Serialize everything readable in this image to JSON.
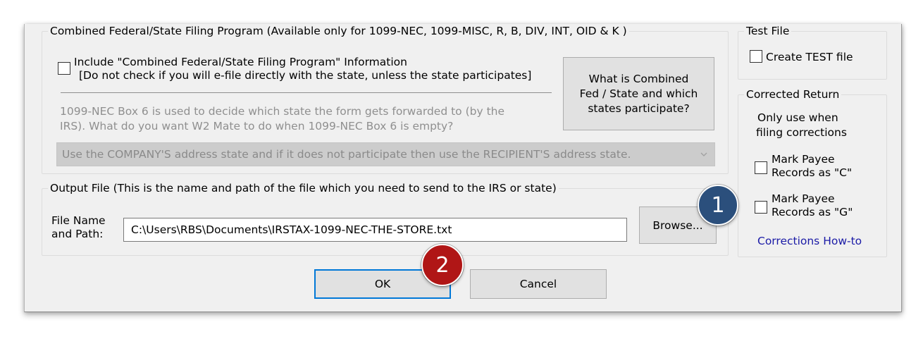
{
  "combined_group": {
    "legend": "Combined Federal/State Filing Program (Available only for 1099-NEC, 1099-MISC, R, B, DIV, INT, OID & K )",
    "include_label_line1": "Include \"Combined Federal/State Filing Program\" Information",
    "include_label_line2": "[Do not check if you will e-file directly with the state, unless the state participates]",
    "include_checked": false,
    "info_line1": "1099-NEC Box 6 is used to decide which state the form gets forwarded to (by the",
    "info_line2": "IRS). What do you want W2 Mate to do when 1099-NEC Box 6 is empty?",
    "state_select_value": "Use the COMPANY'S address state and if it does not participate then use the RECIPIENT'S address state.",
    "what_is_button": {
      "line1": "What is Combined",
      "line2": "Fed / State and which",
      "line3": "states participate?"
    }
  },
  "test_file_group": {
    "legend": "Test File",
    "create_test_label": "Create TEST file",
    "create_test_checked": false
  },
  "corrected_group": {
    "legend": "Corrected Return",
    "note_line1": "Only use when",
    "note_line2": "filing corrections",
    "mark_c_line1": "Mark Payee",
    "mark_c_line2": "Records as \"C\"",
    "mark_g_line1": "Mark Payee",
    "mark_g_line2": "Records as \"G\"",
    "mark_c_checked": false,
    "mark_g_checked": false,
    "howto_link": "Corrections How-to"
  },
  "output_group": {
    "legend": "Output File (This is the name and path of the file which you need to send to the IRS or state)",
    "file_label_line1": "File Name",
    "file_label_line2": "and Path:",
    "file_path_value": "C:\\Users\\RBS\\Documents\\IRSTAX-1099-NEC-THE-STORE.txt",
    "browse_label": "Browse..."
  },
  "footer": {
    "ok_label": "OK",
    "cancel_label": "Cancel"
  },
  "annotations": {
    "badge1": "1",
    "badge2": "2"
  },
  "colors": {
    "badge1": "#2b4f7c",
    "badge2": "#b01616",
    "default_button_border": "#0078d7",
    "link": "#1a1aa6"
  },
  "icons": {
    "combo_arrow": "chevron-down-icon"
  }
}
